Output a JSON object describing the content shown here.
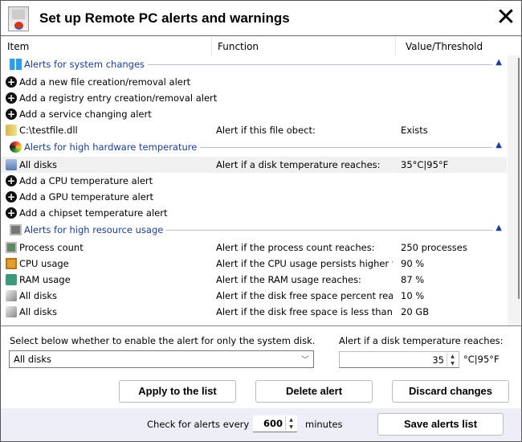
{
  "title": "Set up Remote PC alerts and warnings",
  "columns": {
    "item": "Item",
    "function": "Function",
    "value": "Value/Threshold"
  },
  "groups": [
    {
      "label": "Alerts for system changes",
      "rows": [
        {
          "icon": "plus",
          "item": "Add a new file creation/removal alert",
          "function": "",
          "value": ""
        },
        {
          "icon": "plus",
          "item": "Add a registry entry creation/removal alert",
          "function": "",
          "value": ""
        },
        {
          "icon": "plus",
          "item": "Add a service changing alert",
          "function": "",
          "value": ""
        },
        {
          "icon": "file",
          "item": "C:\\testfile.dll",
          "function": "Alert if this file obect:",
          "value": "Exists"
        }
      ]
    },
    {
      "label": "Alerts for high hardware temperature",
      "rows": [
        {
          "icon": "disk",
          "item": "All disks",
          "function": "Alert if a disk temperature reaches:",
          "value": "35°C|95°F",
          "selected": true
        },
        {
          "icon": "plus",
          "item": "Add a CPU temperature alert",
          "function": "",
          "value": ""
        },
        {
          "icon": "plus",
          "item": "Add a GPU temperature alert",
          "function": "",
          "value": ""
        },
        {
          "icon": "plus",
          "item": "Add a chipset temperature alert",
          "function": "",
          "value": ""
        }
      ]
    },
    {
      "label": "Alerts for high resource usage",
      "rows": [
        {
          "icon": "monitor",
          "item": "Process count",
          "function": "Alert if the process count reaches:",
          "value": "250 processes"
        },
        {
          "icon": "cpu",
          "item": "CPU usage",
          "function": "Alert if the CPU usage persists higher th...",
          "value": "90 %"
        },
        {
          "icon": "ram",
          "item": "RAM usage",
          "function": "Alert if the RAM usage reaches:",
          "value": "87 %"
        },
        {
          "icon": "drive",
          "item": "All disks",
          "function": "Alert if the disk free space percent reac...",
          "value": "10 %"
        },
        {
          "icon": "drive",
          "item": "All disks",
          "function": "Alert if the disk free space is less than:",
          "value": "20 GB"
        }
      ]
    }
  ],
  "editor": {
    "select_label": "Select below whether to enable the alert for only the system disk.",
    "select_value": "All disks",
    "temp_label": "Alert if a disk temperature reaches:",
    "temp_value": "35",
    "temp_unit": "°C|95°F"
  },
  "buttons": {
    "apply": "Apply to the list",
    "delete": "Delete alert",
    "discard": "Discard changes",
    "save": "Save alerts list"
  },
  "footer": {
    "check_label": "Check for alerts every",
    "interval": "600",
    "unit": "minutes"
  }
}
